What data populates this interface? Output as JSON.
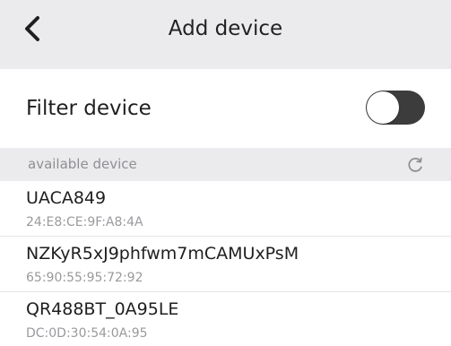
{
  "header": {
    "title": "Add device",
    "back_icon": "chevron-left-icon"
  },
  "filter": {
    "label": "Filter device",
    "toggle_on": false,
    "toggle_color": "#3c3c3c"
  },
  "section": {
    "label": "available device",
    "refresh_icon": "refresh-icon"
  },
  "devices": [
    {
      "name": "UACA849",
      "mac": "24:E8:CE:9F:A8:4A"
    },
    {
      "name": "NZKyR5xJ9phfwm7mCAMUxPsM",
      "mac": "65:90:55:95:72:92"
    },
    {
      "name": "QR488BT_0A95LE",
      "mac": "DC:0D:30:54:0A:95"
    }
  ]
}
